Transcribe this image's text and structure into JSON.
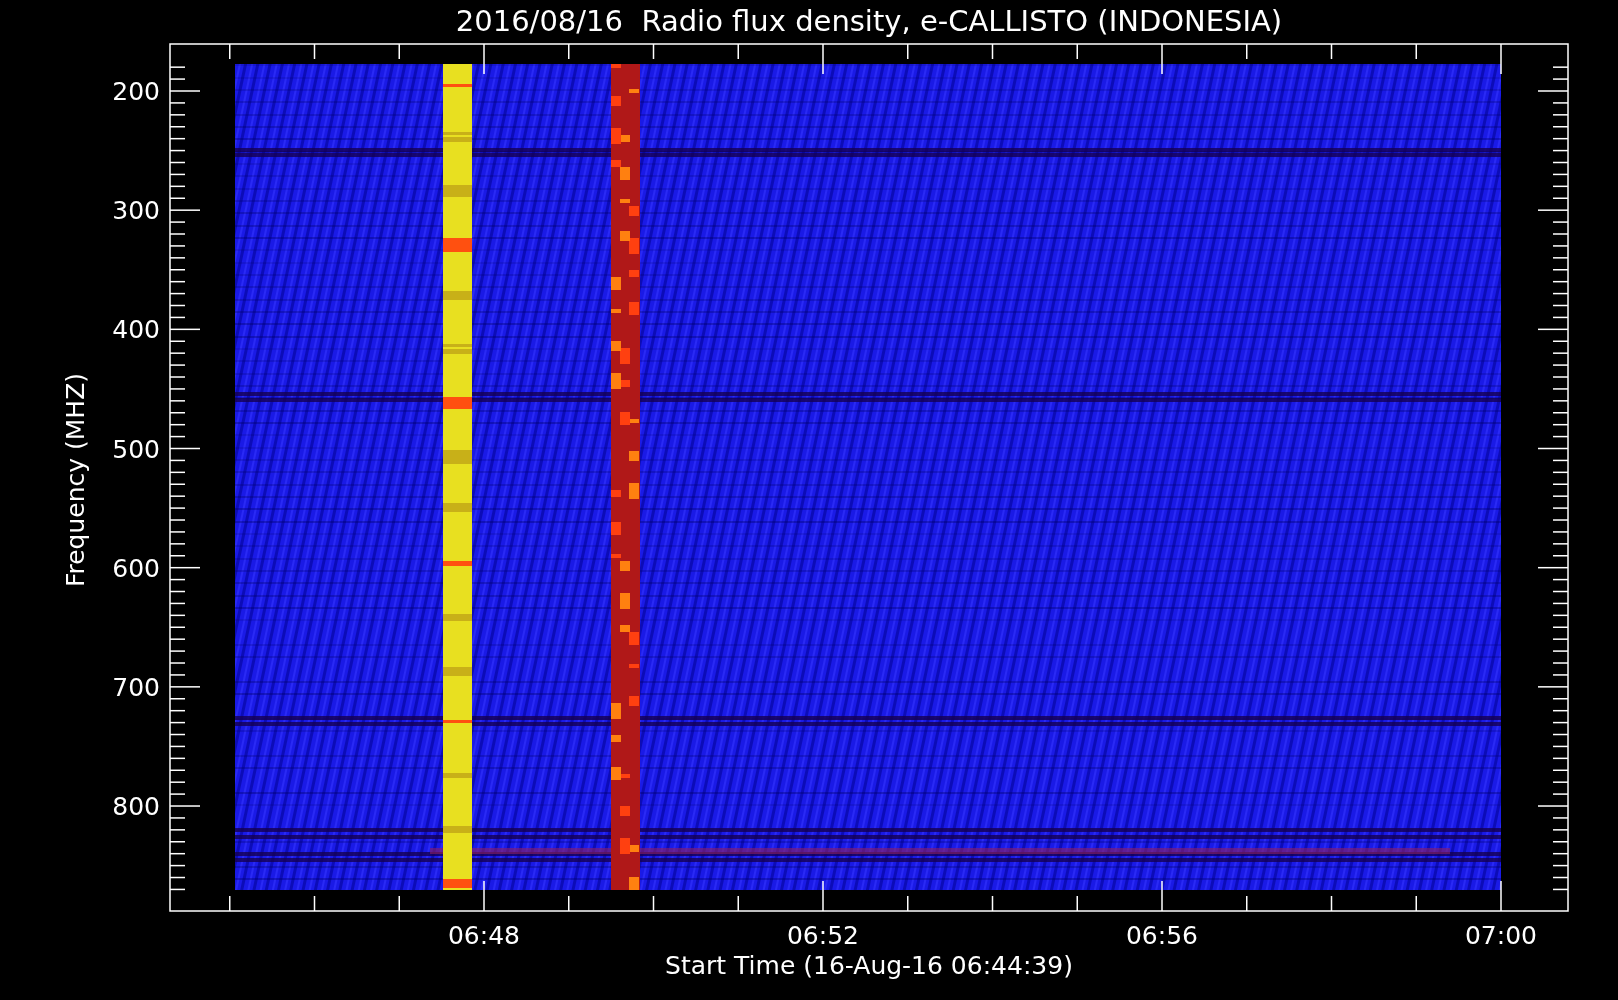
{
  "plot": {
    "title": "2016/08/16  Radio flux density, e-CALLISTO (INDONESIA)",
    "ylabel": "Frequency (MHZ)",
    "xlabel": "Start Time (16-Aug-16 06:44:39)",
    "yticks": [
      "200",
      "300",
      "400",
      "500",
      "600",
      "700",
      "800"
    ],
    "xticks": [
      "06:48",
      "06:52",
      "06:56",
      "07:00"
    ]
  }
}
